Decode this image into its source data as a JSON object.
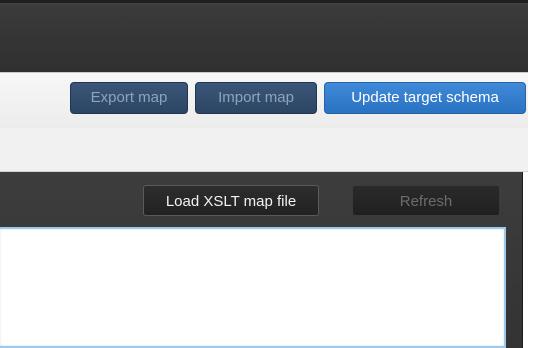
{
  "toolbar": {
    "export_label": "Export map",
    "import_label": "Import map",
    "update_label": "Update target schema"
  },
  "map_panel": {
    "load_label": "Load XSLT map file",
    "refresh_label": "Refresh"
  },
  "colors": {
    "primary": "#2a72c2",
    "disabled_blue": "#2c4564",
    "dark_panel": "#333333"
  }
}
